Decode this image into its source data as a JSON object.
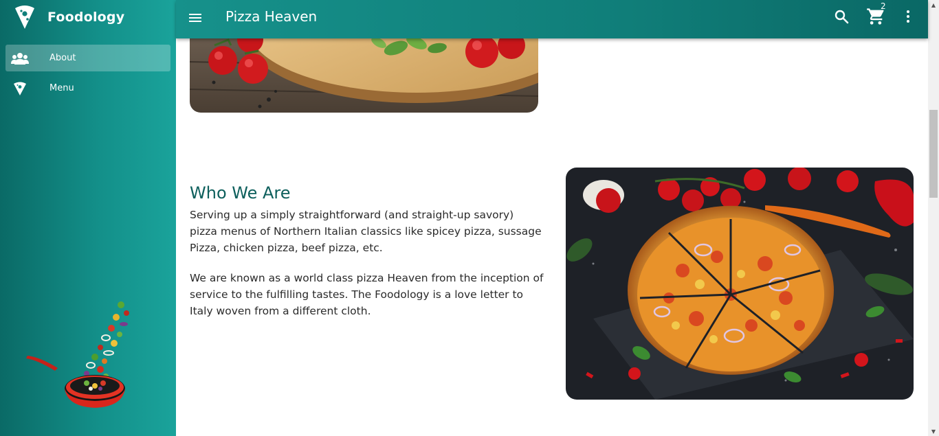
{
  "sidebar": {
    "brand_name": "Foodology",
    "items": [
      {
        "label": "About",
        "icon": "people-icon",
        "active": true
      },
      {
        "label": "Menu",
        "icon": "pizza-slice-icon",
        "active": false
      }
    ]
  },
  "appbar": {
    "title": "Pizza Heaven",
    "cart_count": "2",
    "icons": [
      "menu-icon",
      "search-icon",
      "cart-icon",
      "more-vert-icon"
    ]
  },
  "main": {
    "section_title": "Who We Are",
    "paragraphs": [
      "Serving up a simply straightforward (and straight-up savory) pizza menus of Northern Italian classics like spicey pizza, sussage Pizza, chicken pizza, beef pizza, etc.",
      "We are known as a world class pizza Heaven from the inception of service to the fulfilling tastes. The Foodology is a love letter to Italy woven from a different cloth."
    ]
  },
  "colors": {
    "accent": "#0d5f5c",
    "sidebar_dark": "#0a6a66",
    "sidebar_light": "#1aa39b",
    "pan_red": "#d8261c"
  }
}
